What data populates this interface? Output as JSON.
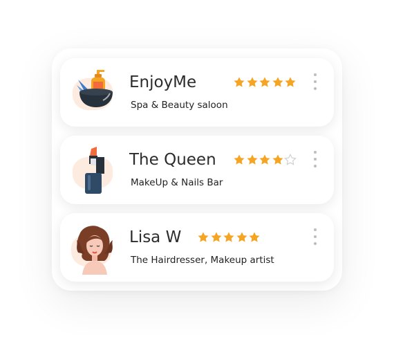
{
  "colors": {
    "star_filled": "#f5a524",
    "star_empty": "#cfcfcf",
    "menu_dots": "#bdbdbd"
  },
  "cards": [
    {
      "name": "EnjoyMe",
      "subtitle": "Spa & Beauty saloon",
      "rating": 5,
      "max_rating": 5,
      "icon": "spa-bowl-icon"
    },
    {
      "name": "The Queen",
      "subtitle": "MakeUp & Nails Bar",
      "rating": 4,
      "max_rating": 5,
      "icon": "lipstick-nail-polish-icon"
    },
    {
      "name": "Lisa W",
      "subtitle": "The Hairdresser, Makeup artist",
      "rating": 5,
      "max_rating": 5,
      "icon": "woman-portrait-icon"
    }
  ]
}
